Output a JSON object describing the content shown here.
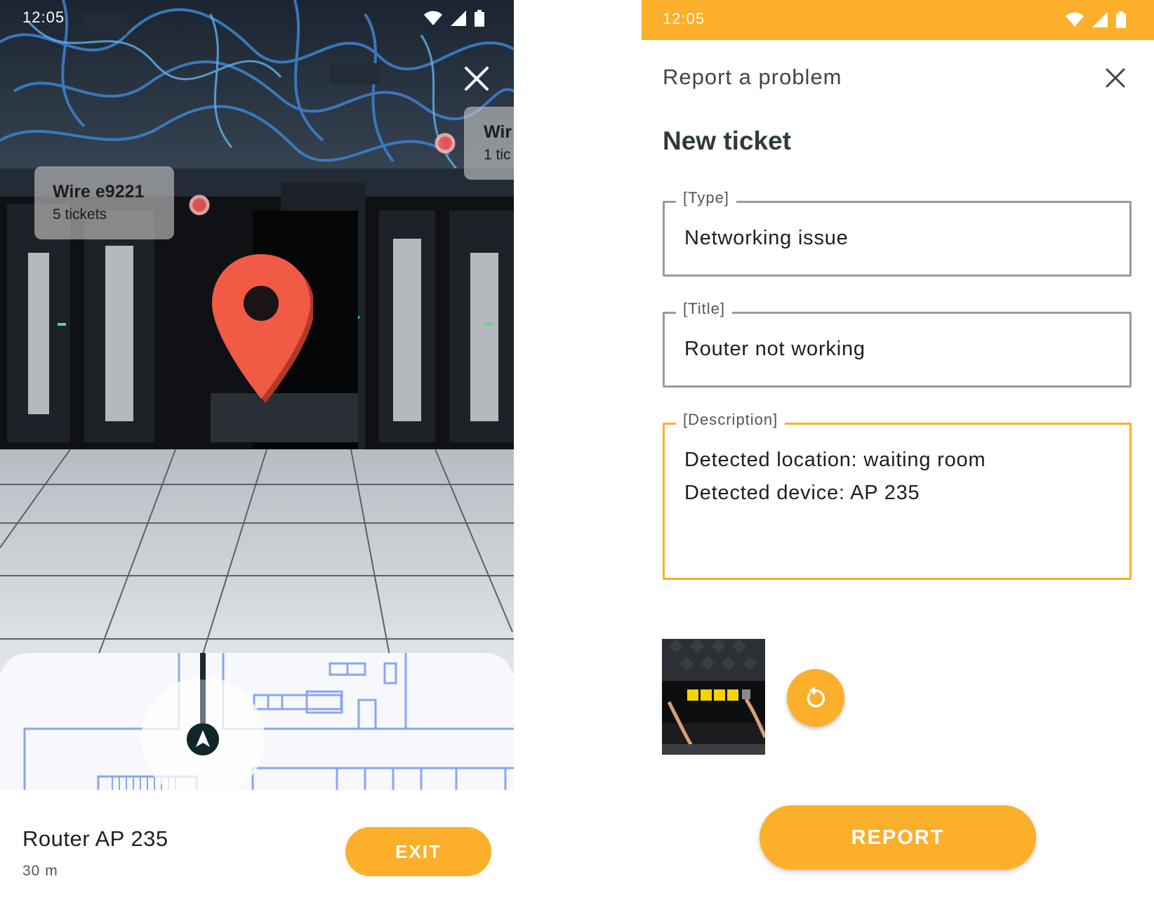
{
  "left_screen": {
    "status": {
      "time": "12:05"
    },
    "ar_labels": [
      {
        "title": "Wire e9221",
        "subtitle": "5 tickets"
      },
      {
        "title": "Wir",
        "subtitle": "1 tic"
      }
    ],
    "target": {
      "name": "Router AP 235",
      "distance": "30 m"
    },
    "exit_label": "EXIT"
  },
  "right_screen": {
    "status": {
      "time": "12:05"
    },
    "sheet_title": "Report a problem",
    "heading": "New ticket",
    "fields": {
      "type": {
        "label": "[Type]",
        "value": "Networking issue"
      },
      "title": {
        "label": "[Title]",
        "value": "Router not working"
      },
      "description": {
        "label": "[Description]",
        "line1": "Detected location: waiting room",
        "line2": "Detected device: AP 235"
      }
    },
    "report_label": "REPORT"
  },
  "colors": {
    "accent": "#fcaf2a",
    "pin": "#f15a45",
    "focus_border": "#fcaf2a",
    "idle_border": "#9a9a9a"
  },
  "icons": [
    "wifi-icon",
    "signal-icon",
    "battery-icon",
    "close-icon",
    "map-pin-icon",
    "navigation-arrow-icon",
    "refresh-icon"
  ]
}
